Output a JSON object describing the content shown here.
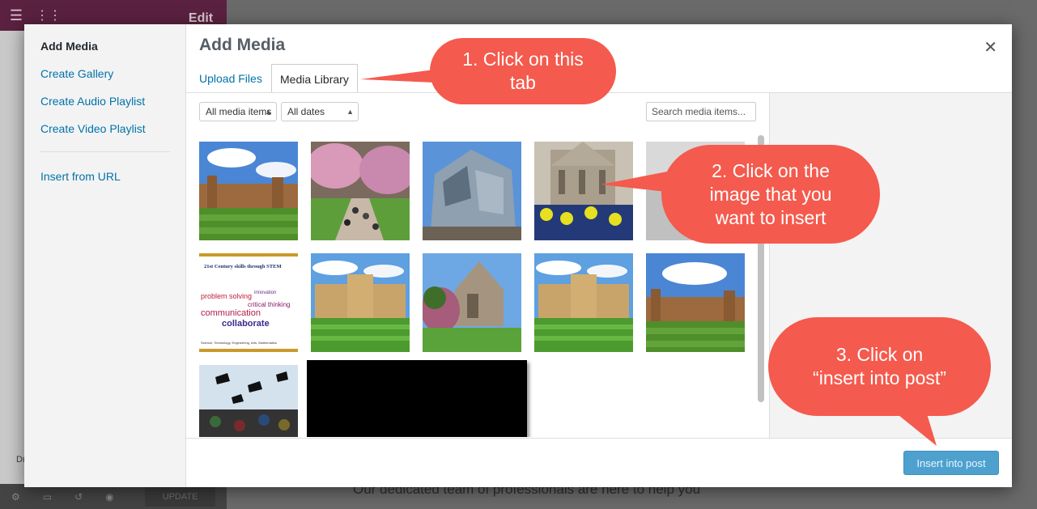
{
  "background": {
    "editor_title": "Edit Text Editor",
    "page_text": "Our dedicated team of professionals are here to help you",
    "update_button": "UPDATE",
    "partial_label": "Dr"
  },
  "modal": {
    "title": "Add Media",
    "close_icon": "close-icon",
    "menu": {
      "heading": "Add Media",
      "items": [
        "Create Gallery",
        "Create Audio Playlist",
        "Create Video Playlist",
        "Insert from URL"
      ]
    },
    "tabs": [
      {
        "label": "Upload Files",
        "active": false
      },
      {
        "label": "Media Library",
        "active": true
      }
    ],
    "filters": {
      "type_value": "All media items",
      "date_value": "All dates"
    },
    "search": {
      "placeholder": "Search media items..."
    },
    "media_items": [
      {
        "subject": "college-lawn"
      },
      {
        "subject": "cherry-blossom-path"
      },
      {
        "subject": "modern-glass-building"
      },
      {
        "subject": "crowd-in-front-of-chapel"
      },
      {
        "subject": "partially-hidden-image"
      },
      {
        "subject": "21st-century-skills-word-cloud"
      },
      {
        "subject": "college-facade"
      },
      {
        "subject": "gothic-building-with-tree"
      },
      {
        "subject": "college-facade"
      },
      {
        "subject": "college-lawn"
      },
      {
        "subject": "graduation-caps-thrown"
      },
      {
        "subject": "redacted-black-box"
      }
    ],
    "word_cloud": {
      "heading": "21st Century skills through STEM",
      "words": [
        "problem solving",
        "innovation",
        "critical thinking",
        "communication",
        "collaborate"
      ],
      "footer": "Science, Technology, Engineering, Arts, Mathematics"
    },
    "insert_button": "Insert into post",
    "accent_color": "#0073aa"
  },
  "annotations": [
    {
      "step": "1.",
      "text_line1": "1.  Click on this",
      "text_line2": "tab"
    },
    {
      "step": "2.",
      "text_line1": "2.  Click on the",
      "text_line2": "image that you",
      "text_line3": "want to insert"
    },
    {
      "step": "3.",
      "text_line1": "3.  Click on",
      "text_line2": "“insert into post”"
    }
  ],
  "callout_color": "#f45a4d"
}
